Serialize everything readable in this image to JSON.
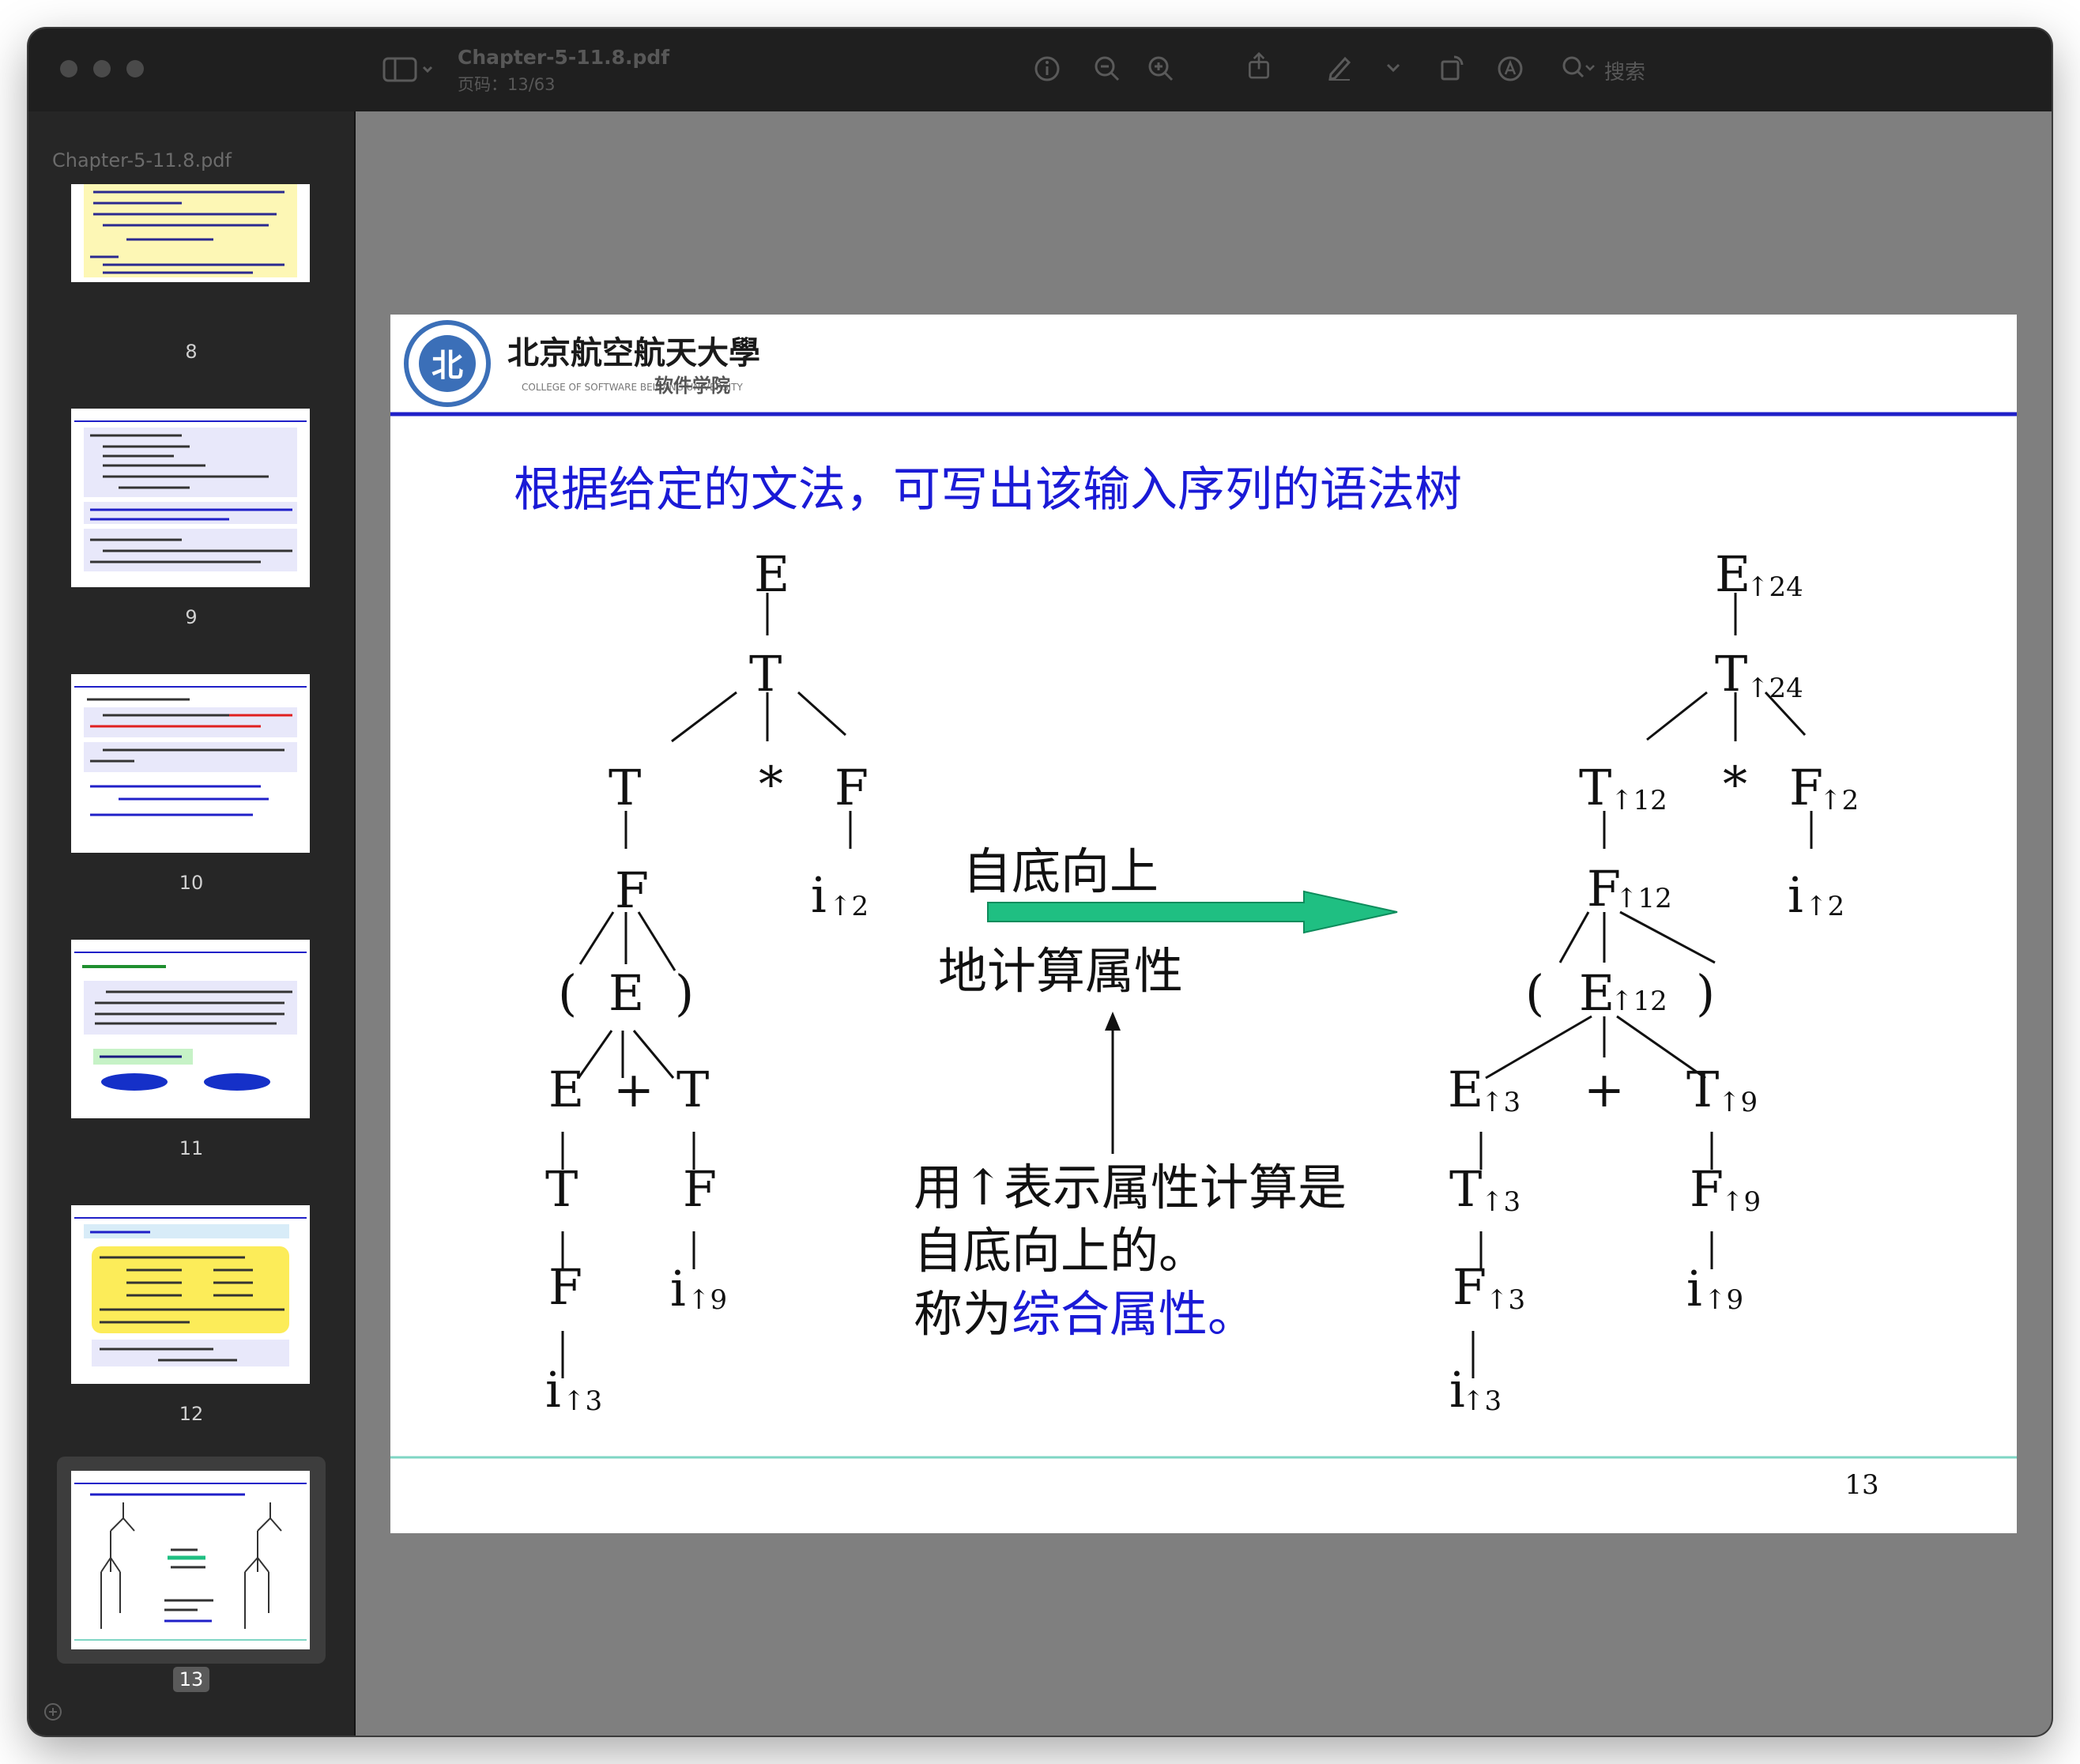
{
  "window": {
    "doc_title": "Chapter-5-11.8.pdf",
    "page_indicator": "页码：13/63",
    "search_placeholder": "搜索"
  },
  "sidebar": {
    "title": "Chapter-5-11.8.pdf",
    "pages": [
      {
        "number": "8"
      },
      {
        "number": "9"
      },
      {
        "number": "10"
      },
      {
        "number": "11"
      },
      {
        "number": "12"
      },
      {
        "number": "13",
        "selected": true
      }
    ]
  },
  "slide": {
    "university": "北京航空航天大學",
    "college_en": "COLLEGE OF SOFTWARE BEIHANG UNIVERSITY",
    "college_cn": "软件学院",
    "heading": "根据给定的文法，可写出该输入序列的语法树",
    "arrow_top_label": "自底向上",
    "arrow_bottom_label": "地计算属性",
    "note_line1": "用↑表示属性计算是",
    "note_line2": "自底向上的。",
    "note_line3_prefix": "称为",
    "note_line3_highlight": "综合属性",
    "note_line3_suffix": "。",
    "page_number": "13",
    "colors": {
      "heading": "#1a1ad6",
      "rule_top": "#2020c8",
      "rule_bottom": "#7fd6c4",
      "arrow": "#1fbf82"
    }
  }
}
